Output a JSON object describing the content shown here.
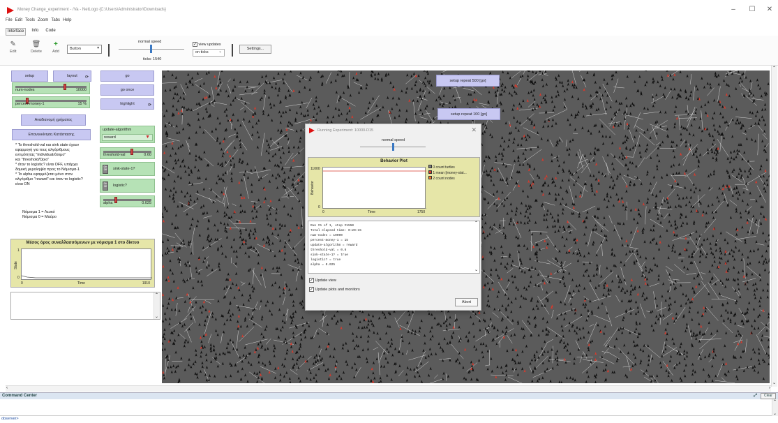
{
  "window": {
    "title": "Money Change_experiment - /Va - NetLogo {C:\\Users\\Administrator\\Downloads}",
    "controls": [
      "–",
      "☐",
      "✕"
    ]
  },
  "menubar": [
    "File",
    "Edit",
    "Tools",
    "Zoom",
    "Tabs",
    "Help"
  ],
  "tabs": [
    "Interface",
    "Info",
    "Code"
  ],
  "toolbar": {
    "edit_label": "Edit",
    "delete_label": "Delete",
    "add_label": "Add",
    "widget_type": "Button",
    "speed_label": "normal speed",
    "ticks_text": "ticks: 1540",
    "view_updates_label": "view updates",
    "view_updates_checked": true,
    "update_mode": "on ticks",
    "settings_label": "Settings..."
  },
  "widgets": {
    "setup_label": "setup",
    "layout_label": "layout",
    "go_label": "go",
    "go_once_label": "go once",
    "highlight_label": "highlight",
    "redistribute_label": "Αναδιανομή χρήματος",
    "reset_label": "Επανεκκίνηση Κατάστασης",
    "num_nodes": {
      "label": "num-nodes",
      "value": "10000",
      "fraction": 0.7
    },
    "percent_money": {
      "label": "percent-money-1",
      "value": "15 %",
      "fraction": 0.15
    },
    "threshold": {
      "label": "threshold-val",
      "value": "0.60",
      "fraction": 0.6
    },
    "alpha": {
      "label": "alpha",
      "value": "0.025",
      "fraction": 0.25
    },
    "update_algorithm": {
      "label": "update-algorithm",
      "value": "reward"
    },
    "sink_state": {
      "label": "sink-state-1?",
      "state_top": "On",
      "state_bottom": "Off"
    },
    "logistic": {
      "label": "logistic?",
      "state_top": "On",
      "state_bottom": "Off"
    },
    "notes_text": [
      "* Το threshold-val και sink state έχουν",
      "εφαρμογή για τους αλγόριθμους",
      "εντιμότητας \"individual/άτομο\"",
      "και \"threshold/Όριο\"",
      "* όταν το logistic? είναι OFF, υπάρχει",
      "δομική μεροληψία προς το Νόμισμα-1",
      "* Το alpha εφαρμόζεται μόνο στον",
      "αλγόριθμο \"reward\" και όταν το logistic?",
      "είναι ON"
    ],
    "legend_1": "Νόμισμα 1 = Λευκό",
    "legend_0": "Νόμισμα 0 = Μαύρο",
    "setup_repeat_500": "setup repeat 500 [go]",
    "setup_repeat_100": "setup repeat 100 [go]"
  },
  "left_plot": {
    "title": "Μέσος όρος συναλλασσόμενων με νόμισμα 1 στο δίκτυο",
    "ylabel": "State",
    "xlabel": "Time",
    "y_max": "1",
    "y_min": "0",
    "x_min": "0",
    "x_max": "1910"
  },
  "experiment_dialog": {
    "title": "Running Experiment: 10000-D15",
    "speed_label": "normal speed",
    "plot": {
      "title": "Behavior Plot",
      "ylabel": "Behavior",
      "xlabel": "Time",
      "y_max": "11000",
      "y_min": "0",
      "x_min": "0",
      "x_max": "1750",
      "legend": [
        {
          "label": "0 count turtles",
          "color": "#808080"
        },
        {
          "label": "1 mean [money-stat...",
          "color": "#d83a2c"
        },
        {
          "label": "2 count nodes",
          "color": "#f07828"
        }
      ]
    },
    "log_lines": [
      "Run #1 of 1, step #1550",
      "Total elapsed time: 0:20:15",
      "num-nodes = 10000",
      "percent-money-1 = 15",
      "update-algorithm = reward",
      "threshold-val = 0.6",
      "sink-state-1? = true",
      "logistic? = true",
      "alpha = 0.025"
    ],
    "update_view_label": "Update view",
    "update_plots_label": "Update plots and monitors",
    "abort_label": "Abort"
  },
  "command_center": {
    "title": "Command Center",
    "clear_label": "Clear",
    "prompt": "observer>"
  },
  "colors": {
    "button": "#c8c8f2",
    "slider": "#b6e2b6",
    "plot_bg": "#e6e6a8",
    "view_bg": "#5b5b5b",
    "turtle_black": "#111111",
    "turtle_red": "#d83a2c",
    "link_white": "#ffffff"
  }
}
